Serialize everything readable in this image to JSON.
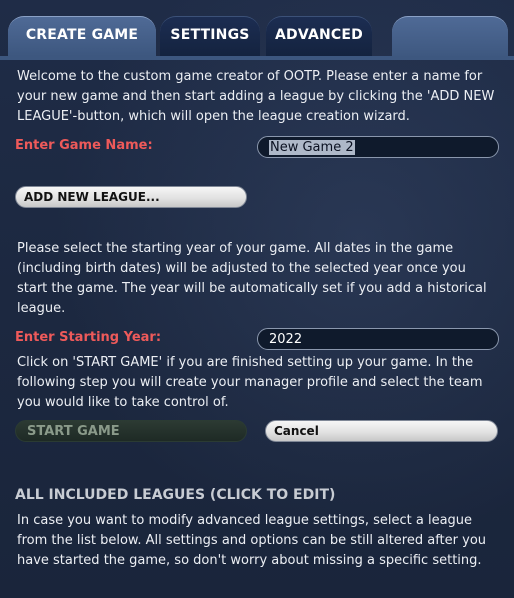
{
  "tabs": {
    "create_game": "CREATE GAME",
    "settings": "SETTINGS",
    "advanced": "ADVANCED"
  },
  "intro_text": "Welcome to the custom game creator of OOTP. Please enter a name for your new game and then start adding a league by clicking the 'ADD NEW LEAGUE'-button, which will open the league creation wizard.",
  "game_name": {
    "label": "Enter Game Name:",
    "value": "New Game 2"
  },
  "add_league_button": "ADD NEW LEAGUE...",
  "year_text": "Please select the starting year of your game. All dates in the game (including birth dates) will be adjusted to the selected year once you start the game. The year will be automatically set if you add a historical league.",
  "starting_year": {
    "label": "Enter Starting Year:",
    "value": "2022"
  },
  "start_text": "Click on 'START GAME' if you are finished setting up your game. In the following step you will create your manager profile and select the team you would like to take control of.",
  "start_game_button": "START GAME",
  "cancel_button": "Cancel",
  "leagues_section": {
    "title": "ALL INCLUDED LEAGUES (CLICK TO EDIT)",
    "text": "In case you want to modify advanced league settings, select a league from the list below. All settings and options can be still altered after you have started the game, so don't worry about missing a specific setting."
  },
  "colors": {
    "background": "#1e2b45",
    "active_tab": "#3d577f",
    "label_red": "#ee5a5a"
  }
}
